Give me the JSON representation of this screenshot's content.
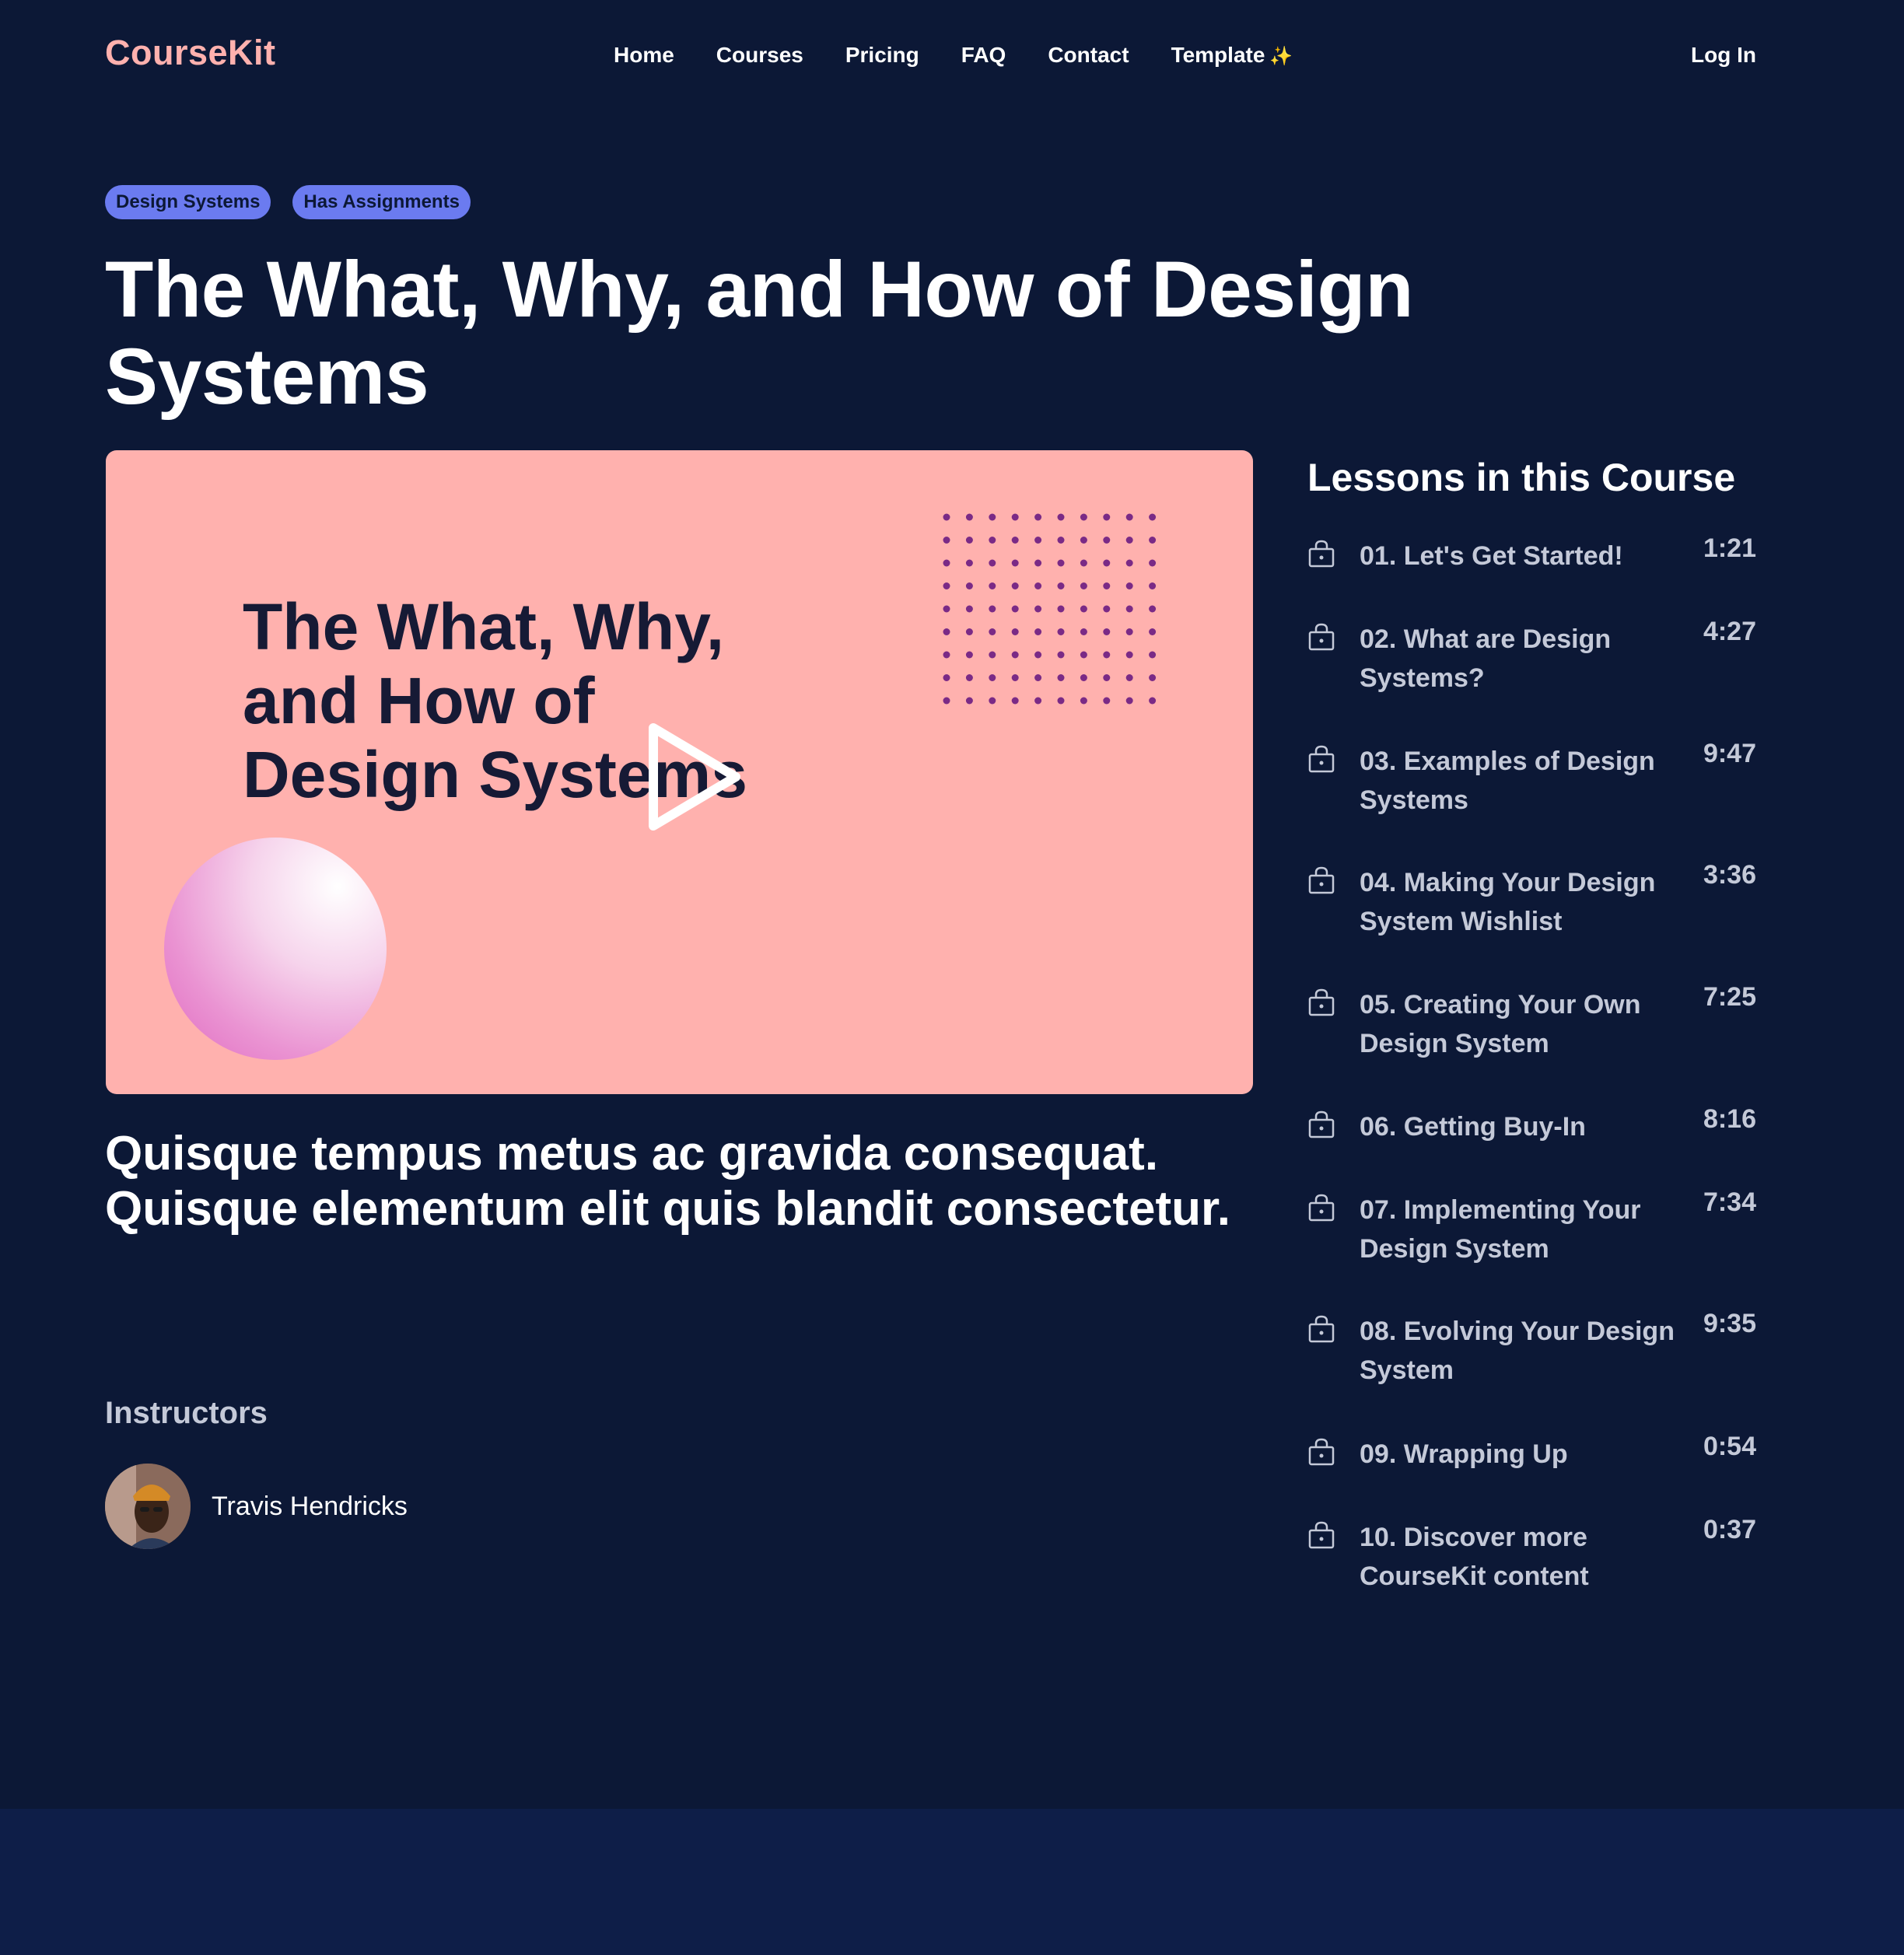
{
  "nav": {
    "logo": "CourseKit",
    "links": [
      "Home",
      "Courses",
      "Pricing",
      "FAQ",
      "Contact",
      "Template"
    ],
    "template_icon": "sparkle-icon",
    "login": "Log In"
  },
  "course": {
    "tags": [
      "Design Systems",
      "Has Assignments"
    ],
    "title": "The What, Why, and How of Design Systems",
    "video_title": "The What, Why, and How of Design Systems",
    "description": "Quisque tempus metus ac gravida consequat. Quisque elementum elit quis blandit consectetur."
  },
  "instructors": {
    "heading": "Instructors",
    "people": [
      {
        "name": "Travis Hendricks"
      }
    ]
  },
  "lessons": {
    "heading": "Lessons in this Course",
    "items": [
      {
        "title": "01. Let's Get Started!",
        "duration": "1:21"
      },
      {
        "title": "02. What are Design Systems?",
        "duration": "4:27"
      },
      {
        "title": "03. Examples of Design Systems",
        "duration": "9:47"
      },
      {
        "title": "04. Making Your Design System Wishlist",
        "duration": "3:36"
      },
      {
        "title": "05. Creating Your Own Design System",
        "duration": "7:25"
      },
      {
        "title": "06. Getting Buy-In",
        "duration": "8:16"
      },
      {
        "title": "07. Implementing Your Design System",
        "duration": "7:34"
      },
      {
        "title": "08. Evolving Your Design System",
        "duration": "9:35"
      },
      {
        "title": "09. Wrapping Up",
        "duration": "0:54"
      },
      {
        "title": "10. Discover more CourseKit content",
        "duration": "0:37"
      }
    ]
  },
  "colors": {
    "background": "#0c1836",
    "footer": "#0e1e48",
    "logo": "#ffb1ae",
    "tag": "#6b7bf0",
    "video_bg": "#ffb1ae",
    "muted_text": "#c4c9d8",
    "dots": "#7a2a86"
  }
}
